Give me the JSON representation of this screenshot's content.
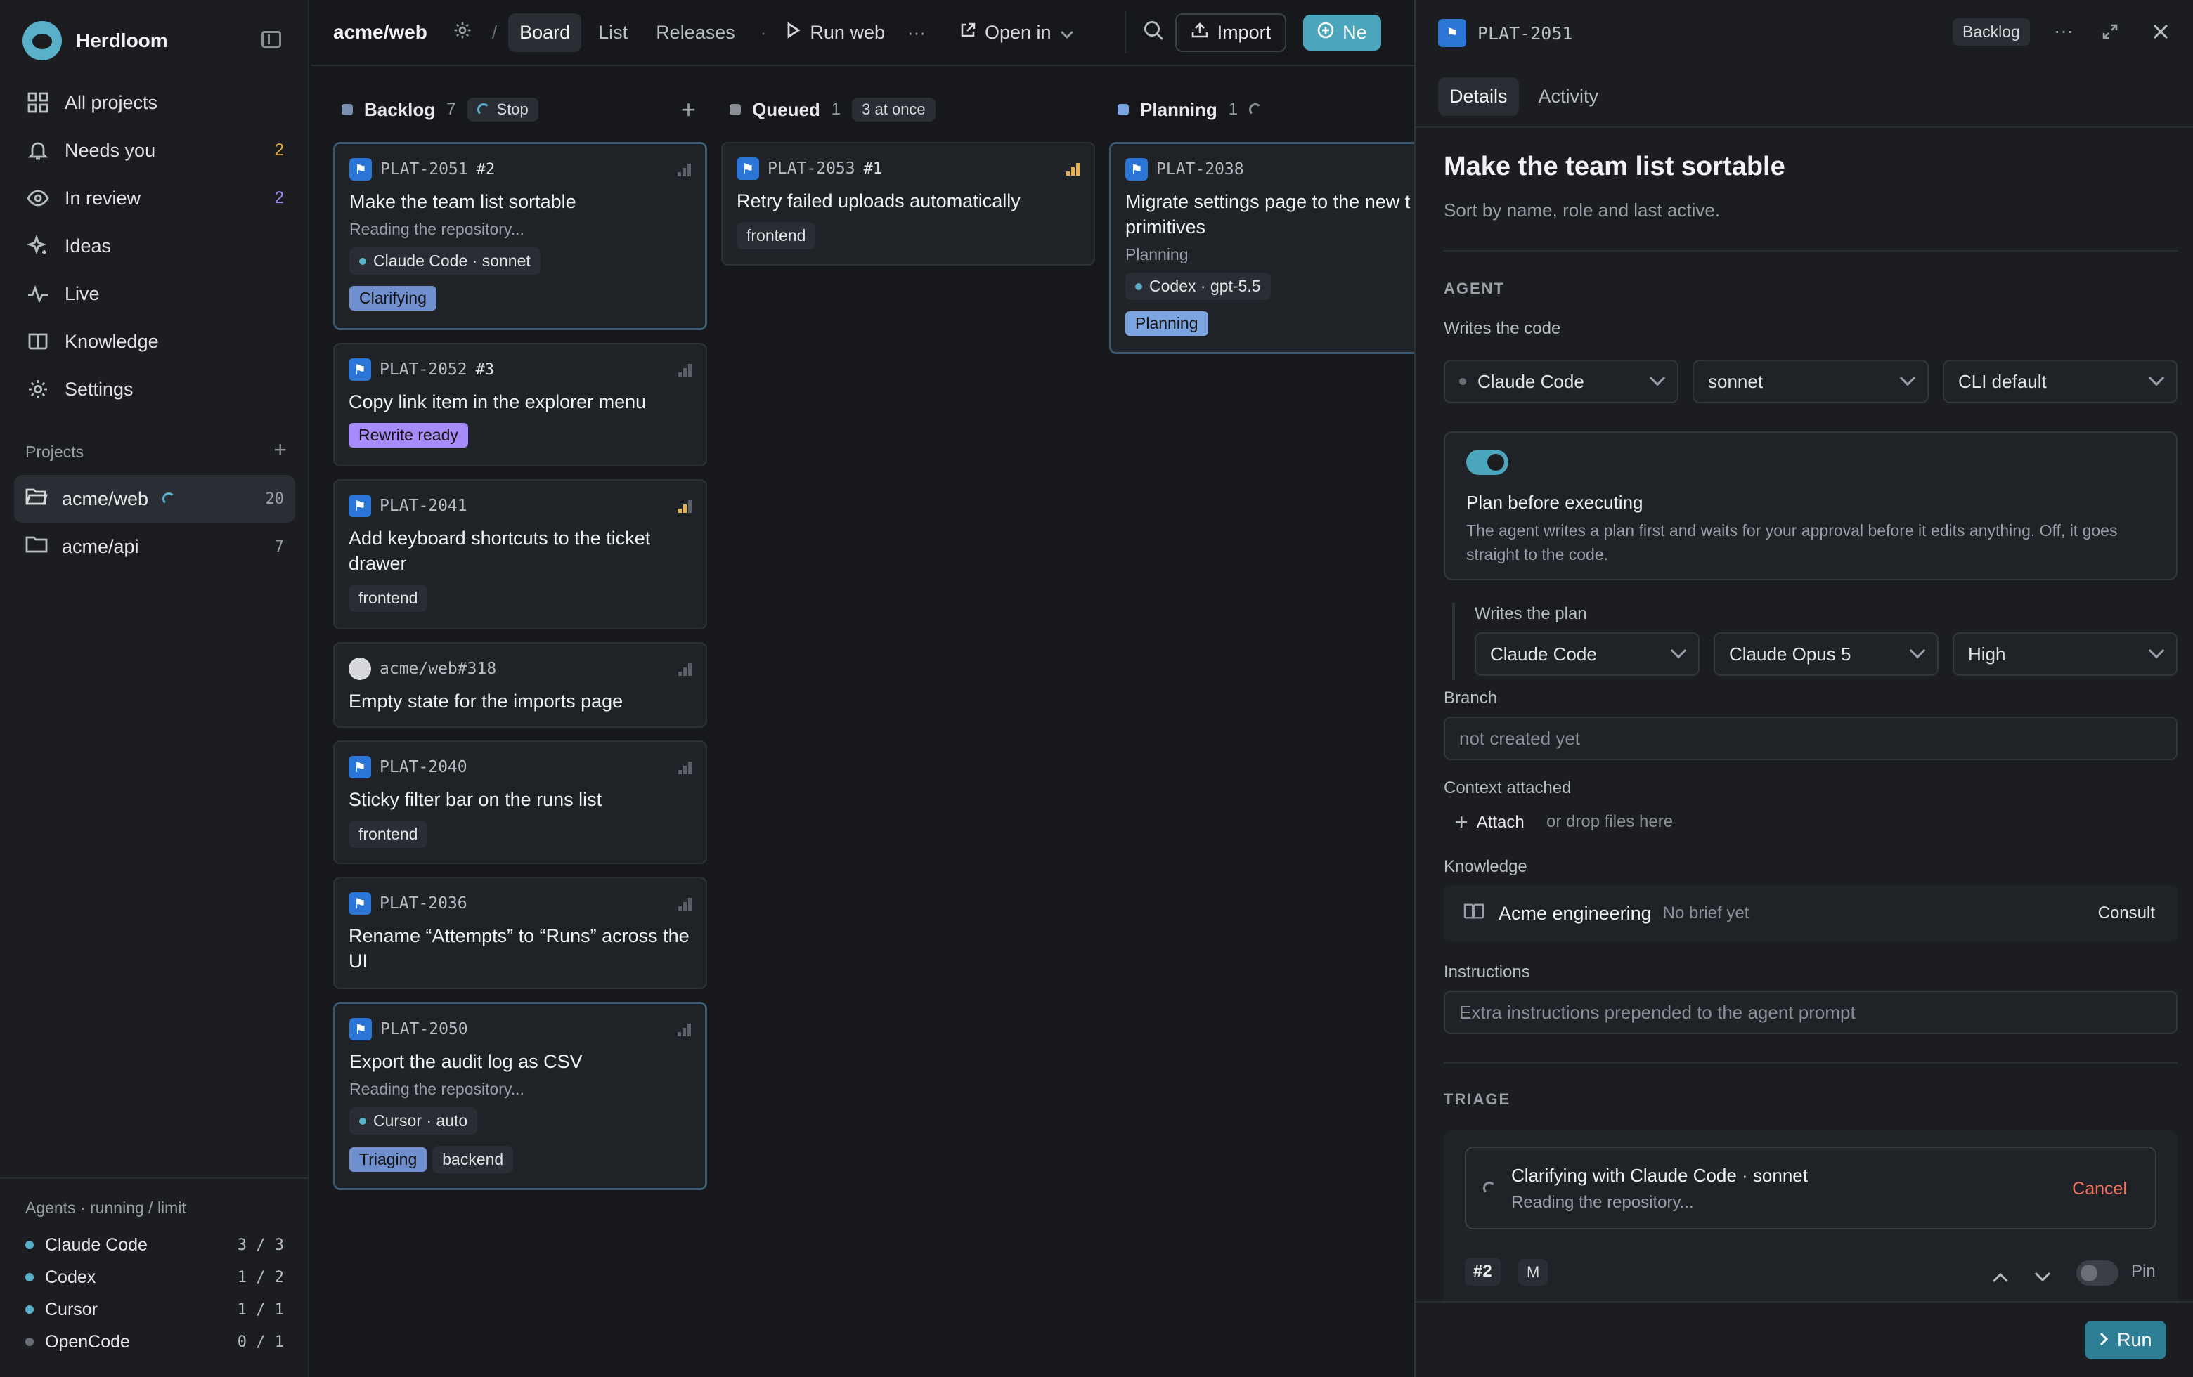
{
  "brand": {
    "name": "Herdloom"
  },
  "nav": [
    {
      "label": "All projects",
      "icon": "grid-icon",
      "count": ""
    },
    {
      "label": "Needs you",
      "icon": "bell-icon",
      "count": "2"
    },
    {
      "label": "In review",
      "icon": "eye-icon",
      "count": "2"
    },
    {
      "label": "Ideas",
      "icon": "sparkle-icon",
      "count": ""
    },
    {
      "label": "Live",
      "icon": "pulse-icon",
      "count": ""
    },
    {
      "label": "Knowledge",
      "icon": "book-icon",
      "count": ""
    },
    {
      "label": "Settings",
      "icon": "gear-icon",
      "count": ""
    }
  ],
  "projects": {
    "heading": "Projects",
    "items": [
      {
        "name": "acme/web",
        "count": "20",
        "active": true
      },
      {
        "name": "acme/api",
        "count": "7",
        "active": false
      }
    ]
  },
  "agents": {
    "heading": "Agents · running / limit",
    "items": [
      {
        "name": "Claude Code",
        "count": "3 / 3",
        "color": "#5ab0c8"
      },
      {
        "name": "Codex",
        "count": "1 / 2",
        "color": "#5ab0c8"
      },
      {
        "name": "Cursor",
        "count": "1 / 1",
        "color": "#5ab0c8"
      },
      {
        "name": "OpenCode",
        "count": "0 / 1",
        "color": "#6a6e76"
      }
    ]
  },
  "topbar": {
    "repo": "acme/web",
    "sep": "/",
    "tabs": [
      "Board",
      "List",
      "Releases"
    ],
    "dot": "·",
    "run": "Run web",
    "more": "···",
    "open_in": "Open in",
    "import": "Import",
    "new": "Ne"
  },
  "columns": {
    "backlog": {
      "name": "Backlog",
      "count": "7",
      "pill": "Stop",
      "color": "#7b8fb0"
    },
    "queued": {
      "name": "Queued",
      "count": "1",
      "pill": "3 at once",
      "color": "#8a8e96"
    },
    "planning": {
      "name": "Planning",
      "count": "1",
      "color": "#7ba4e0"
    }
  },
  "cards": {
    "c2051": {
      "key": "PLAT-2051",
      "rank": "#2",
      "title": "Make the team list sortable",
      "sub": "Reading the repository...",
      "chip": "Claude Code · sonnet",
      "badge": "Clarifying"
    },
    "c2052": {
      "key": "PLAT-2052",
      "rank": "#3",
      "title": "Copy link item in the explorer menu",
      "badge": "Rewrite ready"
    },
    "c2041": {
      "key": "PLAT-2041",
      "title": "Add keyboard shortcuts to the ticket drawer",
      "tag": "frontend"
    },
    "c318": {
      "key": "acme/web#318",
      "title": "Empty state for the imports page"
    },
    "c2040": {
      "key": "PLAT-2040",
      "title": "Sticky filter bar on the runs list",
      "tag": "frontend"
    },
    "c2036": {
      "key": "PLAT-2036",
      "title": "Rename “Attempts” to “Runs” across the UI"
    },
    "c2050": {
      "key": "PLAT-2050",
      "title": "Export the audit log as CSV",
      "sub": "Reading the repository...",
      "chip": "Cursor · auto",
      "badge": "Triaging",
      "tag": "backend"
    },
    "c2053": {
      "key": "PLAT-2053",
      "rank": "#1",
      "title": "Retry failed uploads automatically",
      "tag": "frontend"
    },
    "c2038": {
      "key": "PLAT-2038",
      "title": "Migrate settings page to the new t primitives",
      "sub": "Planning",
      "chip": "Codex · gpt-5.5",
      "badge": "Planning"
    }
  },
  "detail": {
    "key": "PLAT-2051",
    "status": "Backlog",
    "more": "···",
    "tabs": [
      "Details",
      "Activity"
    ],
    "title": "Make the team list sortable",
    "description": "Sort by name, role and last active.",
    "agent_section": "AGENT",
    "writes_code": "Writes the code",
    "code_agent": "Claude Code",
    "code_model": "sonnet",
    "code_effort": "CLI default",
    "plan_toggle_on": true,
    "plan_title": "Plan before executing",
    "plan_desc": "The agent writes a plan first and waits for your approval before it edits anything. Off, it goes straight to the code.",
    "writes_plan": "Writes the plan",
    "plan_agent": "Claude Code",
    "plan_model": "Claude Opus 5",
    "plan_effort": "High",
    "branch_label": "Branch",
    "branch_placeholder": "not created yet",
    "context_label": "Context attached",
    "attach": "Attach",
    "drop": "or drop files here",
    "knowledge_label": "Knowledge",
    "knowledge_name": "Acme engineering",
    "knowledge_note": "No brief yet",
    "consult": "Consult",
    "instructions_label": "Instructions",
    "instructions_placeholder": "Extra instructions prepended to the agent prompt",
    "triage_section": "TRIAGE",
    "triage_title": "Clarifying with Claude Code · sonnet",
    "triage_sub": "Reading the repository...",
    "cancel": "Cancel",
    "rank": "#2",
    "size": "M",
    "pin": "Pin",
    "run": "Run"
  },
  "colors": {
    "accent": "#4aa5bd",
    "clarifying_badge": "#6f8fcf",
    "rewrite_badge": "#a78bfa",
    "planning_badge": "#7ba4e0",
    "cancel": "#f0725f"
  }
}
